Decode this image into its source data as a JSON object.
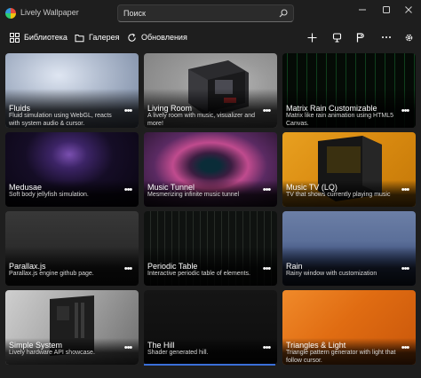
{
  "window": {
    "title": "Lively Wallpaper",
    "search_placeholder": "Поиск",
    "icons": [
      "app-logo",
      "search-icon",
      "minimize-icon",
      "maximize-icon",
      "close-icon"
    ]
  },
  "toolbar": {
    "tabs": [
      {
        "label": "Библиотека",
        "icon": "library-icon",
        "active": true
      },
      {
        "label": "Галерея",
        "icon": "gallery-icon",
        "active": false
      },
      {
        "label": "Обновления",
        "icon": "updates-icon",
        "active": false
      }
    ],
    "tools": [
      "add-icon",
      "screen-layout-icon",
      "control-panel-icon",
      "more-icon",
      "settings-icon"
    ]
  },
  "wallpapers": [
    {
      "name": "Fluids",
      "description": "Fluid simulation using WebGL, reacts with system audio & cursor."
    },
    {
      "name": "Living Room",
      "description": "A lively room with music, visualizer and more!"
    },
    {
      "name": "Matrix Rain Customizable",
      "description": "Matrix like rain animation using HTML5 Canvas."
    },
    {
      "name": "Medusae",
      "description": "Soft body jellyfish simulation."
    },
    {
      "name": "Music Tunnel",
      "description": "Mesmerizing infinite music tunnel"
    },
    {
      "name": "Music TV (LQ)",
      "description": "TV that shows currently playing music"
    },
    {
      "name": "Parallax.js",
      "description": "Parallax.js engine github page."
    },
    {
      "name": "Periodic Table",
      "description": "Interactive periodic table of elements."
    },
    {
      "name": "Rain",
      "description": "Rainy window with customization"
    },
    {
      "name": "Simple System",
      "description": "Lively hardware API showcase."
    },
    {
      "name": "The Hill",
      "description": "Shader generated hill."
    },
    {
      "name": "Triangles & Light",
      "description": "Triangle pattern generator with light that follow cursor."
    }
  ],
  "card_menu_icon": "more-options-icon",
  "colors": {
    "background": "#1e1e1e",
    "accent": "#3a6fd8"
  }
}
